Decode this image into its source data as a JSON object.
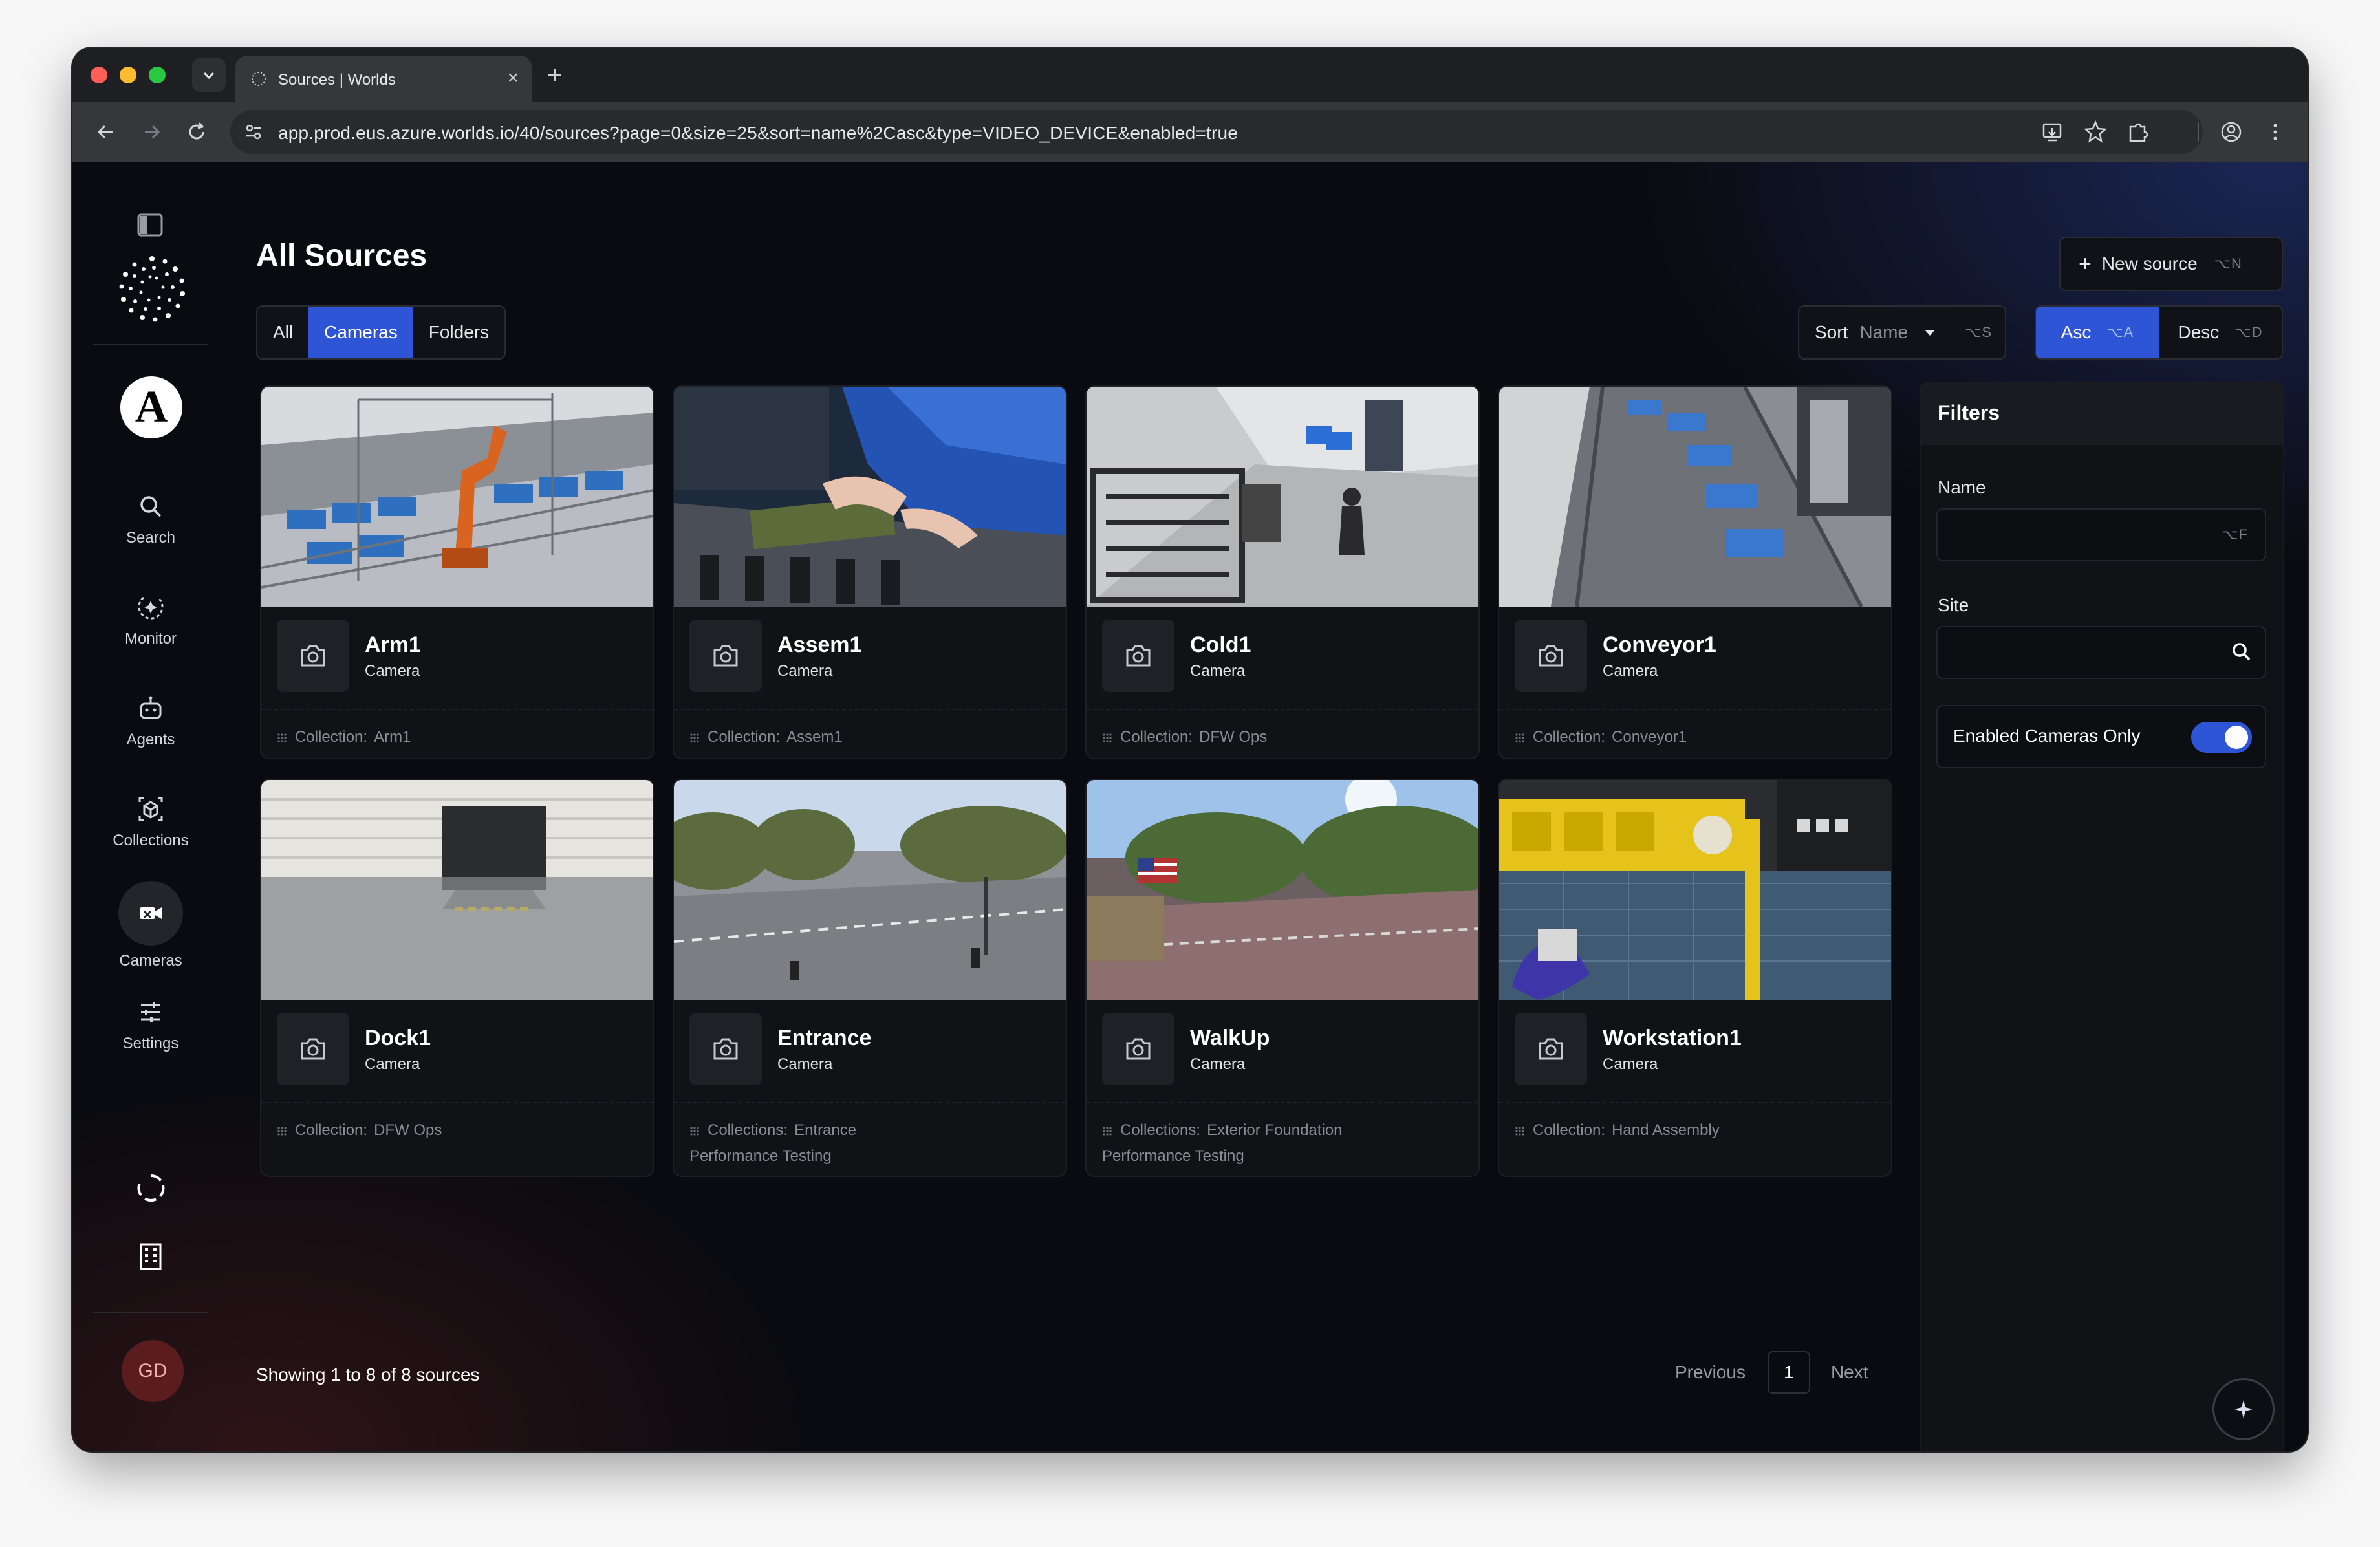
{
  "browser": {
    "tab_title": "Sources | Worlds",
    "url": "app.prod.eus.azure.worlds.io/40/sources?page=0&size=25&sort=name%2Casc&type=VIDEO_DEVICE&enabled=true"
  },
  "sidebar": {
    "org_initial": "A",
    "items": [
      {
        "label": "Search",
        "icon": "search-icon"
      },
      {
        "label": "Monitor",
        "icon": "monitor-icon"
      },
      {
        "label": "Agents",
        "icon": "robot-icon"
      },
      {
        "label": "Collections",
        "icon": "cube-icon"
      },
      {
        "label": "Cameras",
        "icon": "video-camera-icon",
        "active": true
      },
      {
        "label": "Settings",
        "icon": "sliders-icon"
      }
    ],
    "avatar_initials": "GD"
  },
  "header": {
    "title": "All Sources",
    "new_source_label": "New source",
    "new_source_shortcut": "⌥N"
  },
  "type_filter": {
    "options": [
      "All",
      "Cameras",
      "Folders"
    ],
    "selected": "Cameras"
  },
  "sort": {
    "label": "Sort",
    "value": "Name",
    "shortcut": "⌥S",
    "asc_label": "Asc",
    "asc_shortcut": "⌥A",
    "desc_label": "Desc",
    "desc_shortcut": "⌥D",
    "selected": "Asc"
  },
  "cards": [
    {
      "name": "Arm1",
      "type": "Camera",
      "collection_label": "Collection:",
      "collections": "Arm1"
    },
    {
      "name": "Assem1",
      "type": "Camera",
      "collection_label": "Collection:",
      "collections": "Assem1"
    },
    {
      "name": "Cold1",
      "type": "Camera",
      "collection_label": "Collection:",
      "collections": "DFW Ops"
    },
    {
      "name": "Conveyor1",
      "type": "Camera",
      "collection_label": "Collection:",
      "collections": "Conveyor1"
    },
    {
      "name": "Dock1",
      "type": "Camera",
      "collection_label": "Collection:",
      "collections": "DFW Ops"
    },
    {
      "name": "Entrance",
      "type": "Camera",
      "collection_label": "Collections:",
      "collections": "Entrance",
      "collections_line2": "Performance Testing"
    },
    {
      "name": "WalkUp",
      "type": "Camera",
      "collection_label": "Collections:",
      "collections": "Exterior Foundation",
      "collections_line2": "Performance Testing"
    },
    {
      "name": "Workstation1",
      "type": "Camera",
      "collection_label": "Collection:",
      "collections": "Hand Assembly"
    }
  ],
  "filters": {
    "title": "Filters",
    "name_label": "Name",
    "name_value": "",
    "name_shortcut": "⌥F",
    "site_label": "Site",
    "site_value": "",
    "enabled_label": "Enabled Cameras Only",
    "enabled": true
  },
  "footer": {
    "showing": "Showing 1 to 8 of 8 sources",
    "previous": "Previous",
    "page": "1",
    "next": "Next"
  },
  "colors": {
    "accent": "#2d55d6",
    "background": "#0a0b10",
    "card": "#111216"
  }
}
